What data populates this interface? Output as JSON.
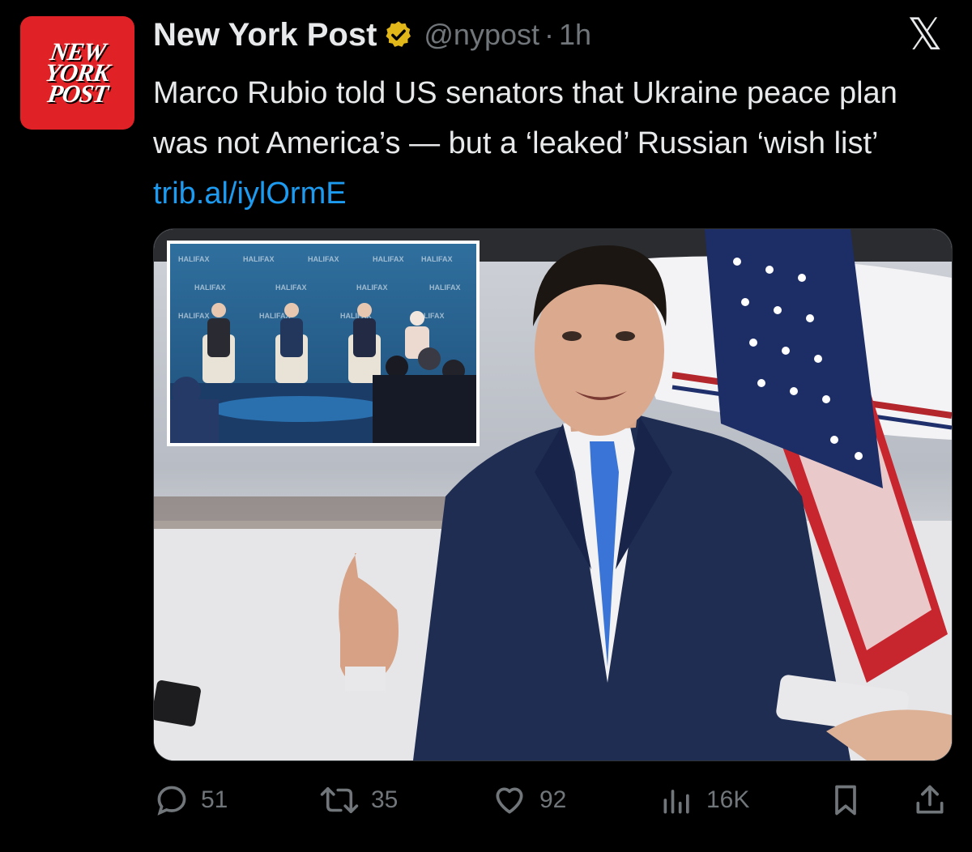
{
  "author": {
    "display_name": "New York Post",
    "handle": "@nypost",
    "separator": "·",
    "timestamp": "1h",
    "avatar_lines": [
      "NEW",
      "YORK",
      "POST"
    ],
    "verified_color": "#e2b719"
  },
  "tweet": {
    "text": "Marco Rubio told US senators that Ukraine peace plan was not America’s — but a ‘leaked’ Russian ‘wish list’ ",
    "link": "trib.al/iylOrmE"
  },
  "media": {
    "inset_banner_word": "HALIFAX"
  },
  "actions": {
    "replies": "51",
    "reposts": "35",
    "likes": "92",
    "views": "16K"
  },
  "colors": {
    "background": "#000000",
    "text": "#e7e9ea",
    "muted": "#71767b",
    "link": "#1d9bf0",
    "brand_red": "#e02226"
  }
}
